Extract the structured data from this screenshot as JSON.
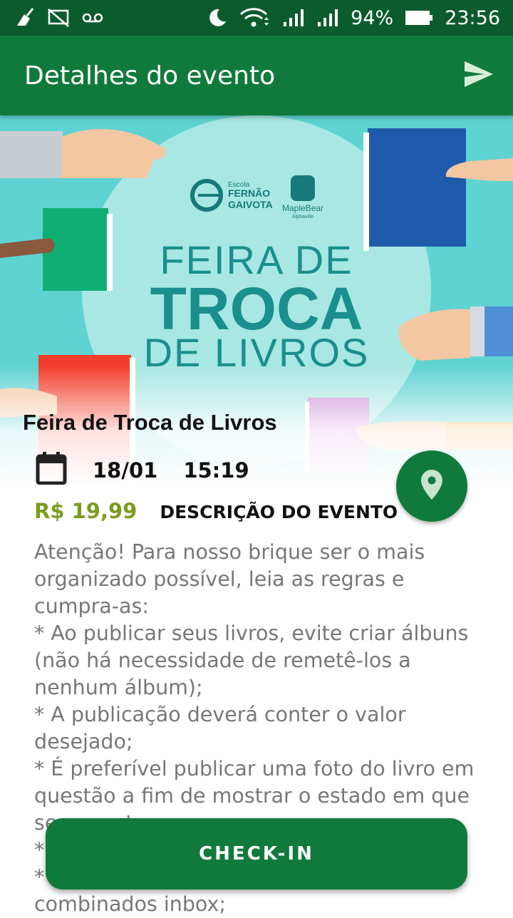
{
  "status_bar": {
    "battery_percent": "94%",
    "time": "23:56",
    "icons": [
      "cleaner-icon",
      "screen-cast-off-icon",
      "voicemail-icon",
      "moon-icon",
      "wifi-icon",
      "signal-icon",
      "signal-icon",
      "battery-icon"
    ]
  },
  "app_bar": {
    "title": "Detalhes do evento",
    "action_icon": "send-icon"
  },
  "hero": {
    "school_label_small": "Escola",
    "school_name_line1": "FERNÃO",
    "school_name_line2": "GAIVOTA",
    "brand": "MapleBear",
    "brand_sub": "Alphaville",
    "headline_1": "FEIRA DE",
    "headline_2": "TROCA",
    "headline_3": "DE LIVROS"
  },
  "event": {
    "title": "Feira de Troca de Livros",
    "date": "18/01",
    "time": "15:19",
    "price": "R$ 19,99",
    "description_label": "DESCRIÇÃO DO EVENTO",
    "description": "Atenção! Para nosso brique ser o mais organizado possível, leia as regras e cumpra-as:\n* Ao publicar seus livros, evite criar álbuns (não há necessidade de remetê-los a nenhum álbum);\n* A publicação deverá conter o valor desejado;\n* É preferível publicar uma foto do livro em questão a fim de mostrar o estado em que se encontra;\n* \n* \ncombinados inbox;"
  },
  "checkin_label": "CHECK-IN",
  "colors": {
    "primary": "#107a3c",
    "status_bar": "#0c5b2c",
    "price": "#7a9d1e",
    "hero_teal": "#5fd3d2"
  }
}
